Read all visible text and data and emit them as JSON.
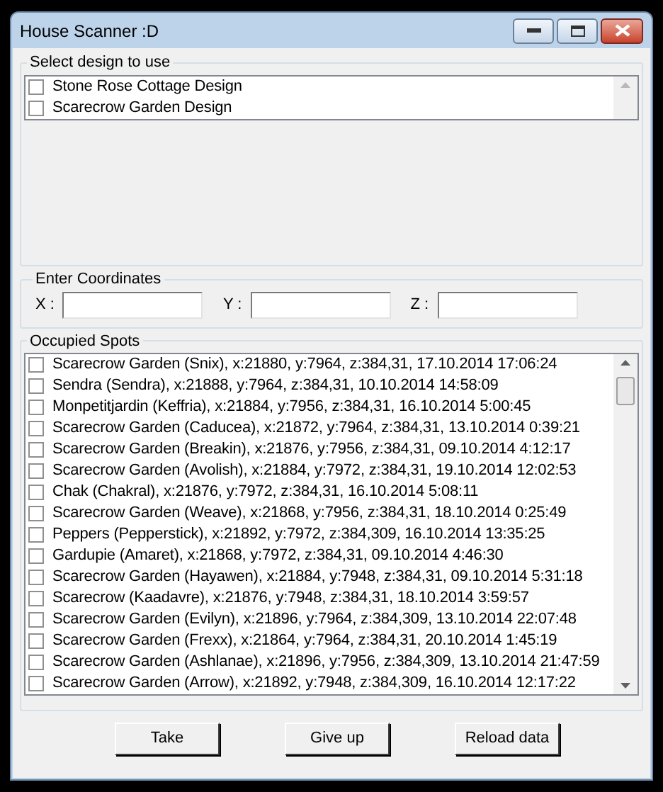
{
  "window": {
    "title": "House Scanner :D"
  },
  "designs": {
    "title": "Select design to use",
    "items": [
      {
        "label": "Stone Rose Cottage Design",
        "checked": false
      },
      {
        "label": "Scarecrow Garden Design",
        "checked": false
      }
    ]
  },
  "coordinates": {
    "title": "Enter Coordinates",
    "fields": [
      {
        "label": "X :"
      },
      {
        "label": "Y :"
      },
      {
        "label": "Z :"
      }
    ]
  },
  "spots": {
    "title": "Occupied Spots",
    "items": [
      {
        "label": "Scarecrow Garden (Snix), x:21880, y:7964, z:384,31, 17.10.2014 17:06:24",
        "checked": false
      },
      {
        "label": "Sendra (Sendra), x:21888, y:7964, z:384,31, 10.10.2014 14:58:09",
        "checked": false
      },
      {
        "label": "Monpetitjardin (Keffria), x:21884, y:7956, z:384,31, 16.10.2014 5:00:45",
        "checked": false
      },
      {
        "label": "Scarecrow Garden (Caducea), x:21872, y:7964, z:384,31, 13.10.2014 0:39:21",
        "checked": false
      },
      {
        "label": "Scarecrow Garden (Breakin), x:21876, y:7956, z:384,31, 09.10.2014 4:12:17",
        "checked": false
      },
      {
        "label": "Scarecrow Garden (Avolish), x:21884, y:7972, z:384,31, 19.10.2014 12:02:53",
        "checked": false
      },
      {
        "label": "Chak (Chakral), x:21876, y:7972, z:384,31, 16.10.2014 5:08:11",
        "checked": false
      },
      {
        "label": "Scarecrow Garden (Weave), x:21868, y:7956, z:384,31, 18.10.2014 0:25:49",
        "checked": false
      },
      {
        "label": "Peppers (Pepperstick), x:21892, y:7972, z:384,309, 16.10.2014 13:35:25",
        "checked": false
      },
      {
        "label": "Gardupie (Amaret), x:21868, y:7972, z:384,31, 09.10.2014 4:46:30",
        "checked": false
      },
      {
        "label": "Scarecrow Garden (Hayawen), x:21884, y:7948, z:384,31, 09.10.2014 5:31:18",
        "checked": false
      },
      {
        "label": "Scarecrow (Kaadavre), x:21876, y:7948, z:384,31, 18.10.2014 3:59:57",
        "checked": false
      },
      {
        "label": "Scarecrow Garden (Evilyn), x:21896, y:7964, z:384,309, 13.10.2014 22:07:48",
        "checked": false
      },
      {
        "label": "Scarecrow Garden (Frexx), x:21864, y:7964, z:384,31, 20.10.2014 1:45:19",
        "checked": false
      },
      {
        "label": "Scarecrow Garden (Ashlanae), x:21896, y:7956, z:384,309, 13.10.2014 21:47:59",
        "checked": false
      },
      {
        "label": "Scarecrow Garden (Arrow), x:21892, y:7948, z:384,309, 16.10.2014 12:17:22",
        "checked": false
      }
    ]
  },
  "buttons": [
    {
      "label": "Take"
    },
    {
      "label": "Give up"
    },
    {
      "label": "Reload data"
    }
  ]
}
